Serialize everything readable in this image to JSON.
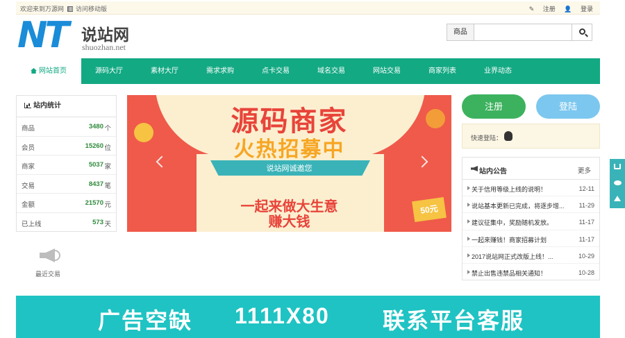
{
  "topbar": {
    "welcome": "欢迎来到万源网",
    "mobile_link": "访问移动版",
    "register": "注册",
    "login": "登录"
  },
  "logo": {
    "mark": "NT",
    "name": "说站网",
    "domain": "shuozhan.net"
  },
  "search": {
    "category": "商品",
    "placeholder": "",
    "icon": "search-icon"
  },
  "nav": {
    "items": [
      {
        "label": "网站首页",
        "active": true
      },
      {
        "label": "源码大厅"
      },
      {
        "label": "素材大厅"
      },
      {
        "label": "需求求购"
      },
      {
        "label": "点卡交易"
      },
      {
        "label": "域名交易"
      },
      {
        "label": "网站交易"
      },
      {
        "label": "商家列表"
      },
      {
        "label": "业界动态"
      }
    ]
  },
  "stats": {
    "title": "站内统计",
    "rows": [
      {
        "label": "商品",
        "value": "3480",
        "unit": "个"
      },
      {
        "label": "会员",
        "value": "15260",
        "unit": "位"
      },
      {
        "label": "商家",
        "value": "5037",
        "unit": "家"
      },
      {
        "label": "交易",
        "value": "8437",
        "unit": "笔"
      },
      {
        "label": "金额",
        "value": "21570",
        "unit": "元"
      },
      {
        "label": "已上线",
        "value": "573",
        "unit": "天"
      }
    ]
  },
  "recent": {
    "label": "最近交易"
  },
  "banner": {
    "title": "源码商家",
    "subtitle": "火热招募中",
    "invite": "说站网诚邀您",
    "slogan1": "一起来做大生意",
    "slogan2": "赚大钱",
    "money": "50元"
  },
  "auth": {
    "register_button": "注册",
    "login_button": "登陆",
    "quick_login": "快速登陆："
  },
  "notice": {
    "title": "站内公告",
    "more": "更多",
    "items": [
      {
        "text": "关于信用等级上线的说明！",
        "date": "12-11"
      },
      {
        "text": "说站基本更新已完成，将逐步增...",
        "date": "11-29"
      },
      {
        "text": "建议征集中，奖励随机发放。",
        "date": "11-17"
      },
      {
        "text": "一起来赚钱！商家招募计划",
        "date": "11-17"
      },
      {
        "text": "2017说站网正式改版上线！...",
        "date": "10-29"
      },
      {
        "text": "禁止出售违禁品相关通知！",
        "date": "10-28"
      }
    ]
  },
  "ad": {
    "part1": "广告空缺",
    "part2": "1111X80",
    "part3": "联系平台客服"
  },
  "colors": {
    "nav": "#13a983",
    "register": "#3db25e",
    "login": "#7cc7ef",
    "ad": "#1fc3c3",
    "banner": "#ef5a4a"
  }
}
